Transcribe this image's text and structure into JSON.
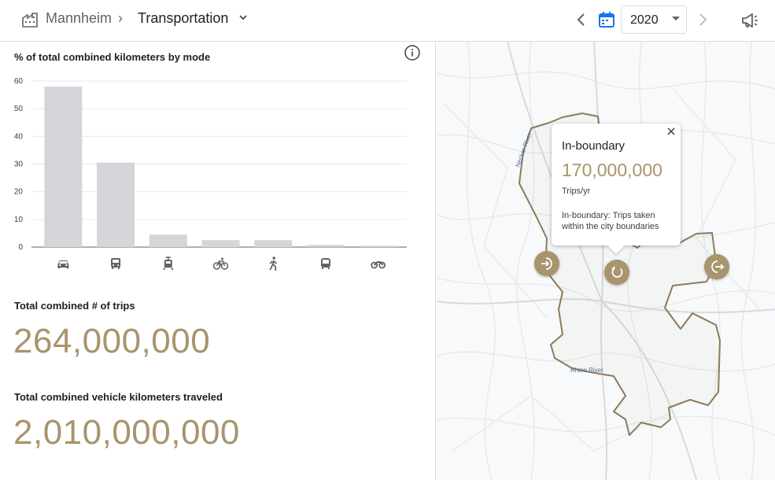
{
  "header": {
    "city": "Mannheim",
    "separator": "›",
    "section": "Transportation",
    "year": "2020",
    "icons": {
      "city": "city-buildings-icon",
      "section_menu": "chevron-down-icon",
      "prev": "chevron-left-icon",
      "calendar": "calendar-icon",
      "next": "chevron-right-icon",
      "feedback": "megaphone-icon"
    }
  },
  "chart": {
    "title": "% of total combined kilometers by mode",
    "info_icon": "info-icon"
  },
  "chart_data": {
    "type": "bar",
    "title": "% of total combined kilometers by mode",
    "categories": [
      "car",
      "bus",
      "tram",
      "bicycle",
      "walking",
      "bus",
      "motorcycle"
    ],
    "category_icons": [
      "car-icon",
      "bus-icon",
      "tram-icon",
      "bicycle-icon",
      "walking-icon",
      "coach-icon",
      "motorcycle-icon"
    ],
    "values": [
      58,
      30.5,
      4.5,
      2.5,
      2.5,
      0.8,
      0.5
    ],
    "ylim": [
      0,
      60
    ],
    "yticks": [
      0,
      10,
      20,
      30,
      40,
      50,
      60
    ],
    "grid": true,
    "bar_color": "#d3d5d8"
  },
  "stats": [
    {
      "label": "Total combined # of trips",
      "value": "264,000,000"
    },
    {
      "label": "Total combined vehicle kilometers traveled",
      "value": "2,010,000,000"
    }
  ],
  "map": {
    "labels": {
      "neckar": "Neckar River",
      "rhine": "Rhine River"
    },
    "boundary_color": "#8b7b5a",
    "buttons": [
      {
        "name": "inbound-button",
        "icon": "inbound-icon"
      },
      {
        "name": "in-boundary-button",
        "icon": "in-boundary-icon"
      },
      {
        "name": "outbound-button",
        "icon": "outbound-icon"
      }
    ],
    "tooltip": {
      "title": "In-boundary",
      "value": "170,000,000",
      "unit": "Trips/yr",
      "description": "In-boundary: Trips taken within the city boundaries",
      "close_icon": "close-icon"
    }
  },
  "colors": {
    "accent": "#a8946d",
    "calendar": "#1a73e8"
  }
}
